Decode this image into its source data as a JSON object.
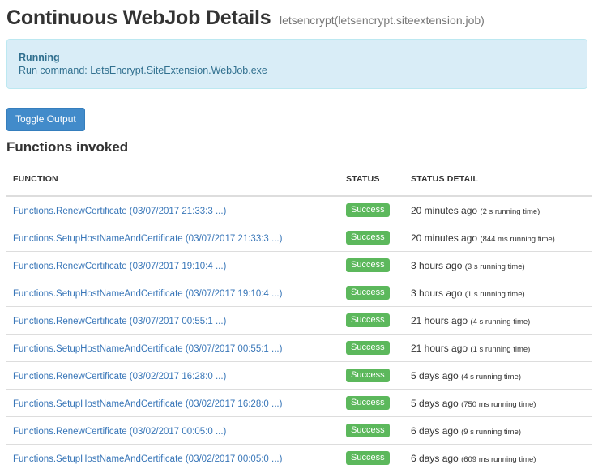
{
  "header": {
    "title": "Continuous WebJob Details",
    "subtitle": "letsencrypt(letsencrypt.siteextension.job)"
  },
  "alert": {
    "status": "Running",
    "run_command": "Run command: LetsEncrypt.SiteExtension.WebJob.exe"
  },
  "toolbar": {
    "toggle_output_label": "Toggle Output"
  },
  "functions": {
    "section_title": "Functions invoked",
    "columns": [
      "FUNCTION",
      "STATUS",
      "STATUS DETAIL"
    ],
    "rows": [
      {
        "function": "Functions.RenewCertificate (03/07/2017 21:33:3 ...)",
        "status": "Success",
        "ago": "20 minutes ago",
        "runtime": "(2 s running time)"
      },
      {
        "function": "Functions.SetupHostNameAndCertificate (03/07/2017 21:33:3 ...)",
        "status": "Success",
        "ago": "20 minutes ago",
        "runtime": "(844 ms running time)"
      },
      {
        "function": "Functions.RenewCertificate (03/07/2017 19:10:4 ...)",
        "status": "Success",
        "ago": "3 hours ago",
        "runtime": "(3 s running time)"
      },
      {
        "function": "Functions.SetupHostNameAndCertificate (03/07/2017 19:10:4 ...)",
        "status": "Success",
        "ago": "3 hours ago",
        "runtime": "(1 s running time)"
      },
      {
        "function": "Functions.RenewCertificate (03/07/2017 00:55:1 ...)",
        "status": "Success",
        "ago": "21 hours ago",
        "runtime": "(4 s running time)"
      },
      {
        "function": "Functions.SetupHostNameAndCertificate (03/07/2017 00:55:1 ...)",
        "status": "Success",
        "ago": "21 hours ago",
        "runtime": "(1 s running time)"
      },
      {
        "function": "Functions.RenewCertificate (03/02/2017 16:28:0 ...)",
        "status": "Success",
        "ago": "5 days ago",
        "runtime": "(4 s running time)"
      },
      {
        "function": "Functions.SetupHostNameAndCertificate (03/02/2017 16:28:0 ...)",
        "status": "Success",
        "ago": "5 days ago",
        "runtime": "(750 ms running time)"
      },
      {
        "function": "Functions.RenewCertificate (03/02/2017 00:05:0 ...)",
        "status": "Success",
        "ago": "6 days ago",
        "runtime": "(9 s running time)"
      },
      {
        "function": "Functions.SetupHostNameAndCertificate (03/02/2017 00:05:0 ...)",
        "status": "Success",
        "ago": "6 days ago",
        "runtime": "(609 ms running time)"
      }
    ]
  },
  "colors": {
    "link": "#3876b8",
    "success": "#5cb85c",
    "alert_bg": "#d9edf7",
    "button": "#428bca"
  }
}
